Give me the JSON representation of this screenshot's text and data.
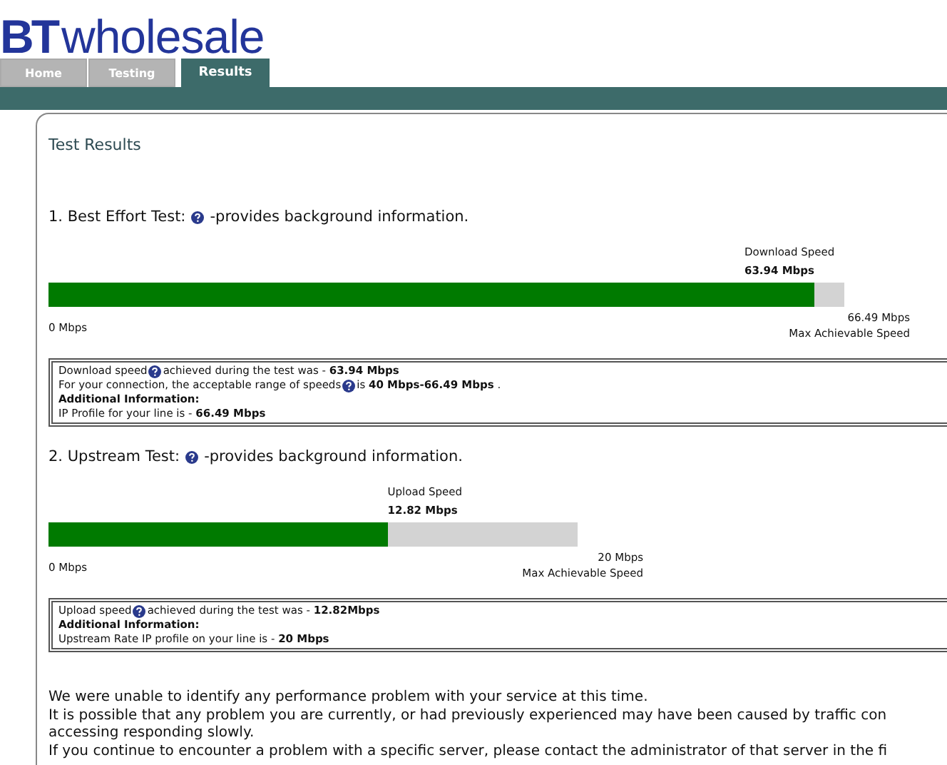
{
  "logo": {
    "brand": "BT",
    "name": "wholesale"
  },
  "tabs": [
    {
      "label": "Home",
      "selected": false
    },
    {
      "label": "Testing",
      "selected": false
    },
    {
      "label": "Results",
      "selected": true
    }
  ],
  "panel": {
    "title": "Test Results",
    "tests": [
      {
        "heading": "1. Best Effort Test:",
        "hint": "-provides background information.",
        "speed_label": "Download Speed",
        "speed": "63.94 Mbps",
        "level": 0.9617,
        "min": "0 Mbps",
        "max": "66.49 Mbps",
        "max_label": "Max Achievable Speed",
        "info": [
          {
            "text": "Download speed",
            "help": true,
            "rest": "achieved during the test was - **63.94 Mbps**"
          },
          {
            "text": "For your connection, the acceptable range of speeds",
            "help": true,
            "rest": "is **40 Mbps-66.49 Mbps** ."
          },
          {
            "text": "**Additional Information:**"
          },
          {
            "text": "IP Profile for your line is - **66.49 Mbps**"
          }
        ]
      },
      {
        "heading": "2. Upstream Test:",
        "hint": "-provides background information.",
        "speed_label": "Upload Speed",
        "speed": "12.82 Mbps",
        "level": 0.641,
        "min": "0 Mbps",
        "max": "20 Mbps",
        "max_label": "Max Achievable Speed",
        "info": [
          {
            "text": "Upload speed",
            "help": true,
            "rest": " achieved during the test was - **12.82Mbps**"
          },
          {
            "text": "**Additional Information:**"
          },
          {
            "text": "Upstream Rate IP profile on your line is - **20 Mbps**"
          }
        ]
      }
    ],
    "message": [
      "We were unable to identify any performance problem with your service at this time.",
      "It is possible that any problem you are currently, or had previously experienced may have been caused by traffic con",
      "accessing responding slowly.",
      "If you continue to encounter a problem with a specific server, please contact the administrator of that server in the fi"
    ]
  }
}
